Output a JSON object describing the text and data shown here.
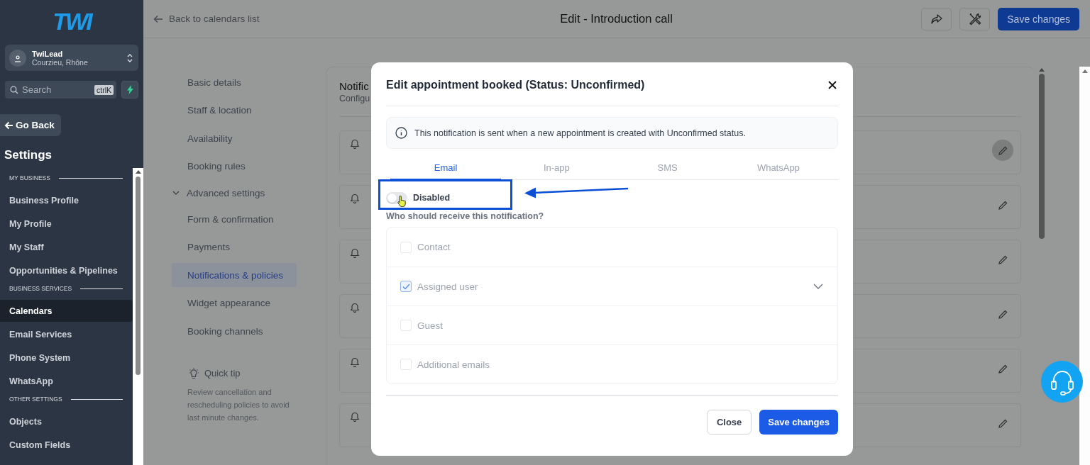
{
  "sidebar": {
    "logo": "TWI",
    "account": {
      "name": "TwiLead",
      "location": "Courzieu, Rhône"
    },
    "search": {
      "placeholder": "Search",
      "shortcut": "ctrlK"
    },
    "back": "Go Back",
    "title": "Settings",
    "sections": [
      {
        "heading": "MY BUSINESS",
        "items": [
          {
            "label": "Business Profile",
            "selected": false
          },
          {
            "label": "My Profile",
            "selected": false
          },
          {
            "label": "My Staff",
            "selected": false
          },
          {
            "label": "Opportunities & Pipelines",
            "selected": false
          }
        ]
      },
      {
        "heading": "BUSINESS SERVICES",
        "items": [
          {
            "label": "Calendars",
            "selected": true
          },
          {
            "label": "Email Services",
            "selected": false
          },
          {
            "label": "Phone System",
            "selected": false
          },
          {
            "label": "WhatsApp",
            "selected": false
          }
        ]
      },
      {
        "heading": "OTHER SETTINGS",
        "items": [
          {
            "label": "Objects",
            "selected": false
          },
          {
            "label": "Custom Fields",
            "selected": false
          }
        ]
      }
    ]
  },
  "header": {
    "back": "Back to calendars list",
    "title": "Edit - Introduction call",
    "save": "Save changes"
  },
  "subnav": [
    {
      "kind": "link",
      "label": "Basic details",
      "selected": false
    },
    {
      "kind": "link",
      "label": "Staff & location",
      "selected": false
    },
    {
      "kind": "link",
      "label": "Availability",
      "selected": false
    },
    {
      "kind": "link",
      "label": "Booking rules",
      "selected": false
    },
    {
      "kind": "group",
      "label": "Advanced settings",
      "expanded": true,
      "children": [
        {
          "label": "Form & confirmation",
          "selected": false
        },
        {
          "label": "Payments",
          "selected": false
        },
        {
          "label": "Notifications & policies",
          "selected": true
        },
        {
          "label": "Widget appearance",
          "selected": false
        },
        {
          "label": "Booking channels",
          "selected": false
        }
      ]
    }
  ],
  "tip": {
    "title": "Quick tip",
    "text": "Review cancellation and rescheduling policies to avoid last minute changes."
  },
  "card": {
    "title": "Notific",
    "subtitle": "Configu",
    "rows": [
      {
        "highlighted": true
      },
      {
        "highlighted": false
      },
      {
        "highlighted": false
      },
      {
        "highlighted": false
      },
      {
        "highlighted": false
      },
      {
        "highlighted": false
      }
    ]
  },
  "modal": {
    "title": "Edit appointment booked (Status: Unconfirmed)",
    "info": "This notification is sent when a new appointment is created with Unconfirmed status.",
    "tabs": [
      {
        "label": "Email",
        "selected": true
      },
      {
        "label": "In-app",
        "selected": false
      },
      {
        "label": "SMS",
        "selected": false
      },
      {
        "label": "WhatsApp",
        "selected": false
      }
    ],
    "toggle": {
      "label": "Disabled",
      "on": false
    },
    "question": "Who should receive this notification?",
    "recipients": [
      {
        "label": "Contact",
        "checked": false,
        "expandable": false
      },
      {
        "label": "Assigned user",
        "checked": true,
        "expandable": true
      },
      {
        "label": "Guest",
        "checked": false,
        "expandable": false
      },
      {
        "label": "Additional emails",
        "checked": false,
        "expandable": false
      }
    ],
    "close": "Close",
    "save": "Save changes"
  }
}
